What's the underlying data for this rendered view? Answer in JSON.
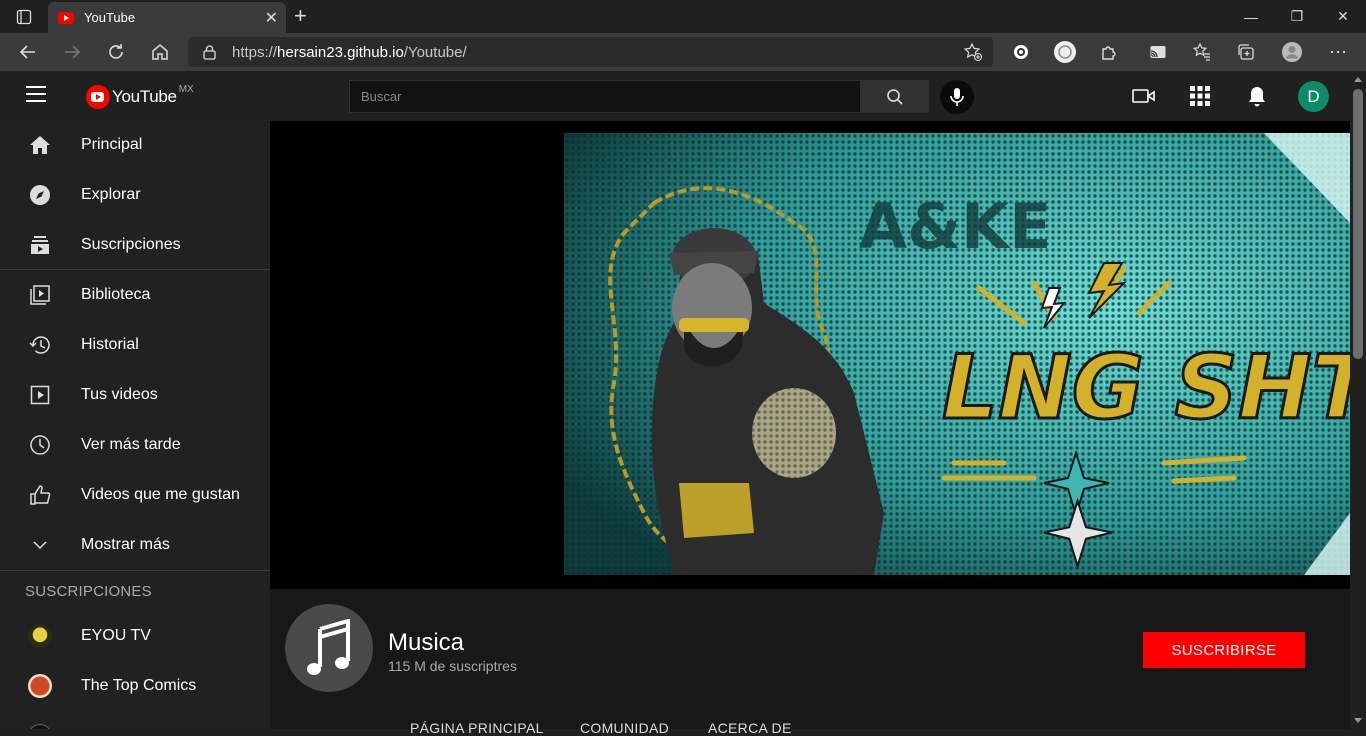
{
  "browser": {
    "tab_title": "YouTube",
    "url_prefix": "https://",
    "url_host": "hersain23.github.io",
    "url_path": "/Youtube/",
    "window": {
      "minimize": "—",
      "maximize": "❐",
      "close": "✕"
    }
  },
  "header": {
    "logo_text": "YouTube",
    "logo_country": "MX",
    "search_placeholder": "Buscar",
    "avatar_letter": "D"
  },
  "sidebar": {
    "main_items": [
      {
        "label": "Principal",
        "icon": "home-icon"
      },
      {
        "label": "Explorar",
        "icon": "compass-icon"
      },
      {
        "label": "Suscripciones",
        "icon": "subscriptions-icon"
      }
    ],
    "library_items": [
      {
        "label": "Biblioteca",
        "icon": "library-icon"
      },
      {
        "label": "Historial",
        "icon": "history-icon"
      },
      {
        "label": "Tus videos",
        "icon": "your-videos-icon"
      },
      {
        "label": "Ver más tarde",
        "icon": "clock-icon"
      },
      {
        "label": "Videos que me gustan",
        "icon": "thumbs-up-icon"
      },
      {
        "label": "Mostrar más",
        "icon": "chevron-down-icon"
      }
    ],
    "subscriptions_title": "SUSCRIPCIONES",
    "subscriptions": [
      {
        "label": "EYOU TV",
        "color": "#c9b020"
      },
      {
        "label": "The Top Comics",
        "color": "#b5391c"
      }
    ]
  },
  "banner": {
    "title_art_text": "LNG SHT",
    "top_art_text": "A&KE"
  },
  "channel": {
    "name": "Musica",
    "subscribers": "115 M de suscriptres",
    "subscribe_label": "SUSCRIBIRSE",
    "tabs": [
      "PÁGINA PRINCIPAL",
      "COMUNIDAD",
      "ACERCA DE"
    ]
  },
  "colors": {
    "accent_red": "#ff0000",
    "avatar_green": "#0f8a6a",
    "banner_teal": "#3fb6b2",
    "banner_gold": "#d4b12a"
  }
}
